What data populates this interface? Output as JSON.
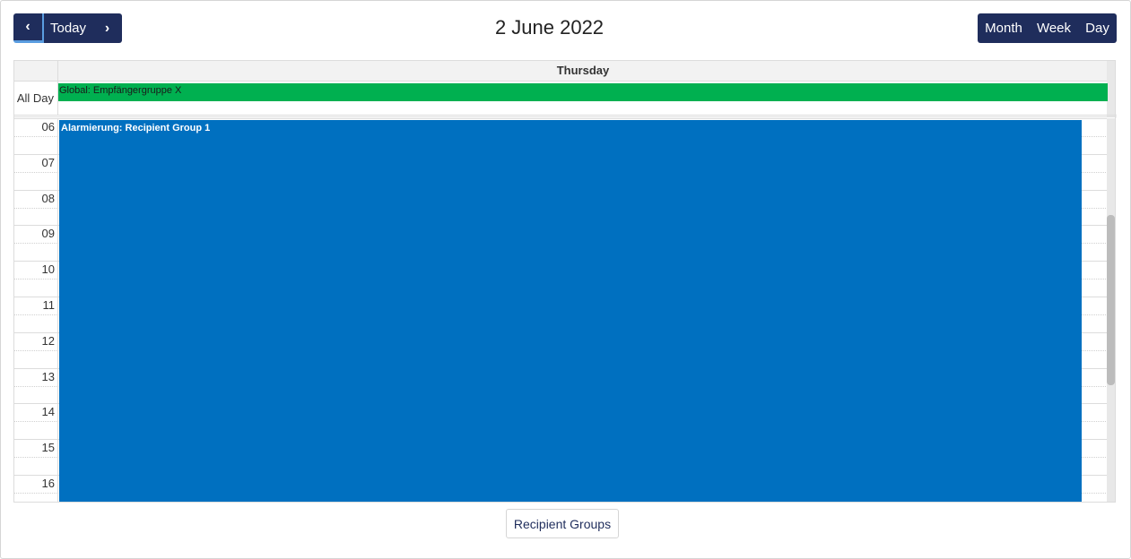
{
  "toolbar": {
    "prev_icon": "chevron-left-icon",
    "prev_glyph": "‹",
    "today_label": "Today",
    "next_icon": "chevron-right-icon",
    "next_glyph": "›",
    "title": "2 June 2022",
    "views": {
      "month": "Month",
      "week": "Week",
      "day": "Day"
    }
  },
  "calendar": {
    "day_header": "Thursday",
    "allday_label": "All Day",
    "allday_event": {
      "title": "Global: Empfängergruppe X",
      "color": "#00b050"
    },
    "hours": [
      "06",
      "07",
      "08",
      "09",
      "10",
      "11",
      "12",
      "13",
      "14",
      "15",
      "16"
    ],
    "timed_event": {
      "title": "Alarmierung: Recipient Group 1",
      "color": "#0070c0"
    }
  },
  "footer": {
    "recipient_groups_label": "Recipient Groups"
  },
  "colors": {
    "primary": "#1f2d5c",
    "accent": "#5a9de0"
  }
}
